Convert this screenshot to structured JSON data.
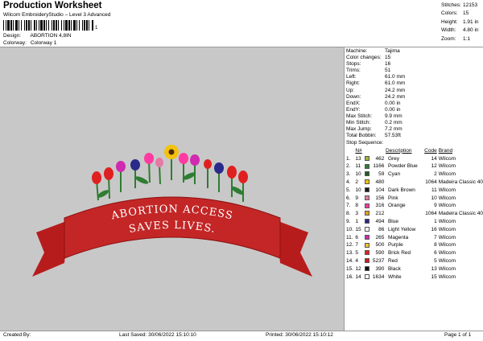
{
  "header": {
    "title": "Production Worksheet",
    "subtitle": "Wilcom EmbroideryStudio – Level 3 Advanced",
    "barcode_suffix": "1",
    "design_label": "Design:",
    "design_value": "ABORTION 4,8IN",
    "colorway_label": "Colorway:",
    "colorway_value": "Colorway 1"
  },
  "summary": [
    {
      "label": "Stitches:",
      "value": "12153"
    },
    {
      "label": "Colors:",
      "value": "15"
    },
    {
      "label": "Height:",
      "value": "1.91 in"
    },
    {
      "label": "Width:",
      "value": "4.80 in"
    },
    {
      "label": "Zoom:",
      "value": "1:1"
    }
  ],
  "stats": [
    {
      "label": "Machine:",
      "value": "Tajima"
    },
    {
      "label": "Color changes:",
      "value": "15"
    },
    {
      "label": "Stops:",
      "value": "16"
    },
    {
      "label": "Trims:",
      "value": "51"
    },
    {
      "label": "Left:",
      "value": "61.0 mm"
    },
    {
      "label": "Right:",
      "value": "61.0 mm"
    },
    {
      "label": "Up:",
      "value": "24.2 mm"
    },
    {
      "label": "Down:",
      "value": "24.2 mm"
    },
    {
      "label": "EndX:",
      "value": "0.00 in"
    },
    {
      "label": "EndY:",
      "value": "0.00 in"
    },
    {
      "label": "Max Stitch:",
      "value": "9.9 mm"
    },
    {
      "label": "Min Stitch:",
      "value": "0.2 mm"
    },
    {
      "label": "Max Jump:",
      "value": "7.2 mm"
    },
    {
      "label": "Total Bobbin:",
      "value": "57.53ft"
    }
  ],
  "sequence": {
    "title": "Stop Sequence:",
    "headers": {
      "n": "N#",
      "description": "Description",
      "code": "Code",
      "brand": "Brand"
    },
    "rows": [
      {
        "stop": "1.",
        "n": "13",
        "color": "#a2b23a",
        "num": "462",
        "description": "Grey",
        "code": "14",
        "brand": "Wilcom"
      },
      {
        "stop": "2.",
        "n": "11",
        "color": "#2e7d32",
        "num": "1166",
        "description": "Powder Blue",
        "code": "12",
        "brand": "Wilcom"
      },
      {
        "stop": "3.",
        "n": "10",
        "color": "#1b5e20",
        "num": "59",
        "description": "Cyan",
        "code": "2",
        "brand": "Wilcom"
      },
      {
        "stop": "4.",
        "n": "2",
        "color": "#f4c20d",
        "num": "480",
        "description": "",
        "code": "1064",
        "brand": "Madeira Classic 40"
      },
      {
        "stop": "5.",
        "n": "10",
        "color": "#1a1a1a",
        "num": "104",
        "description": "Dark Brown",
        "code": "11",
        "brand": "Wilcom"
      },
      {
        "stop": "6.",
        "n": "9",
        "color": "#e57aa6",
        "num": "156",
        "description": "Pink",
        "code": "10",
        "brand": "Wilcom"
      },
      {
        "stop": "7.",
        "n": "8",
        "color": "#ff3aa0",
        "num": "316",
        "description": "Orange",
        "code": "9",
        "brand": "Wilcom"
      },
      {
        "stop": "8.",
        "n": "3",
        "color": "#e0a020",
        "num": "212",
        "description": "",
        "code": "1064",
        "brand": "Madeira Classic 40"
      },
      {
        "stop": "9.",
        "n": "1",
        "color": "#2a2a8a",
        "num": "494",
        "description": "Blue",
        "code": "1",
        "brand": "Wilcom"
      },
      {
        "stop": "10.",
        "n": "15",
        "color": "#ffffff",
        "num": "86",
        "description": "Light Yellow",
        "code": "16",
        "brand": "Wilcom"
      },
      {
        "stop": "11.",
        "n": "6",
        "color": "#d02ab0",
        "num": "265",
        "description": "Magenta",
        "code": "7",
        "brand": "Wilcom"
      },
      {
        "stop": "12.",
        "n": "7",
        "color": "#f0c030",
        "num": "500",
        "description": "Purple",
        "code": "8",
        "brand": "Wilcom"
      },
      {
        "stop": "13.",
        "n": "5",
        "color": "#e02020",
        "num": "590",
        "description": "Brick Red",
        "code": "6",
        "brand": "Wilcom"
      },
      {
        "stop": "14.",
        "n": "4",
        "color": "#c81e1e",
        "num": "5237",
        "description": "Red",
        "code": "5",
        "brand": "Wilcom"
      },
      {
        "stop": "15.",
        "n": "12",
        "color": "#111111",
        "num": "390",
        "description": "Black",
        "code": "13",
        "brand": "Wilcom"
      },
      {
        "stop": "16.",
        "n": "14",
        "color": "#ffffff",
        "num": "1634",
        "description": "White",
        "code": "15",
        "brand": "Wilcom"
      }
    ]
  },
  "artwork": {
    "line1": "ABORTION ACCESS",
    "line2": "SAVES LIVES."
  },
  "footer": {
    "created_by": "Created By:",
    "last_saved": "Last Saved: 30/06/2022 15:10:10",
    "printed": "Printed: 30/06/2022 15:10:12",
    "page": "Page 1 of 1"
  }
}
